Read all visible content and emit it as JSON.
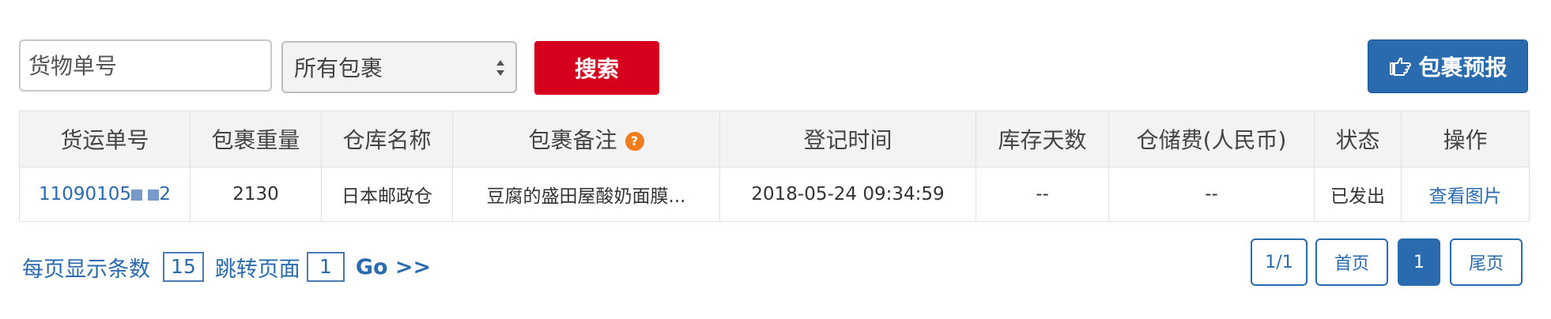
{
  "search": {
    "placeholder": "货物单号"
  },
  "filter": {
    "selected": "所有包裹"
  },
  "buttons": {
    "search": "搜索",
    "report": "包裹预报"
  },
  "table": {
    "headers": [
      "货运单号",
      "包裹重量",
      "仓库名称",
      "包裹备注",
      "登记时间",
      "库存天数",
      "仓储费(人民币)",
      "状态",
      "操作"
    ],
    "help_mark": "?",
    "row": {
      "tracking_prefix": "11090105",
      "tracking_suffix": "2",
      "weight": "2130",
      "warehouse": "日本邮政仓",
      "note": "豆腐的盛田屋酸奶面膜...",
      "time": "2018-05-24 09:34:59",
      "days": "--",
      "fee": "--",
      "status": "已发出",
      "action": "查看图片"
    }
  },
  "pagination": {
    "per_page_label": "每页显示条数",
    "per_page_value": "15",
    "jump_label": "跳转页面",
    "jump_value": "1",
    "go_label": "Go >>",
    "page_info": "1/1",
    "first_label": "首页",
    "current_page": "1",
    "last_label": "尾页"
  },
  "colors": {
    "accent": "#2a6aaf",
    "search_button": "#d6001c",
    "help_icon": "#f07c1b"
  },
  "icons": {
    "report": "hand-pointing-icon",
    "help": "question-icon",
    "select": "chevron-updown-icon"
  }
}
